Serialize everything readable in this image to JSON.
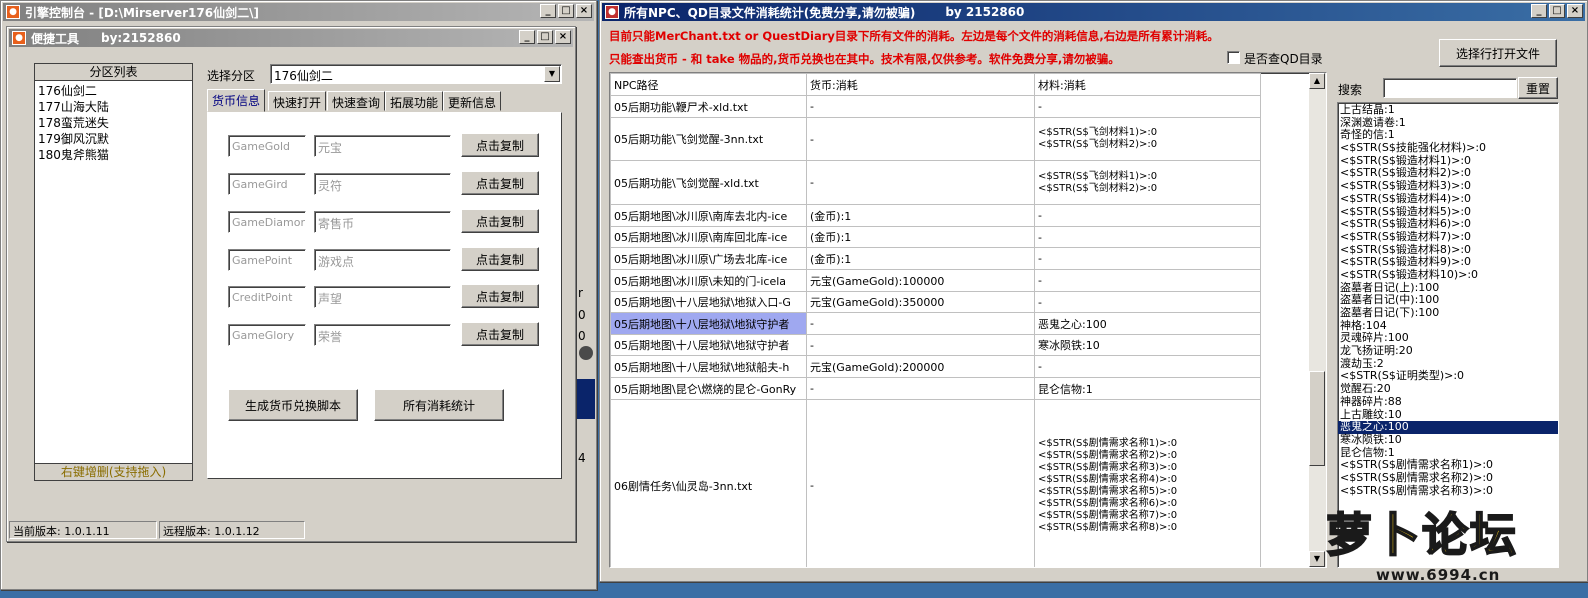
{
  "console_window": {
    "title": "引擎控制台 - [D:\\Mirserver176仙剑二\\]",
    "controls": [
      "_",
      "□",
      "×"
    ]
  },
  "tool_window": {
    "title": "便捷工具",
    "author": "by:2152860",
    "zone_list": {
      "header": "分区列表",
      "items": [
        "176仙剑二",
        "177山海大陆",
        "178蛮荒迷失",
        "179御风沉默",
        "180鬼斧熊猫"
      ],
      "footer": "右键增删(支持拖入)"
    },
    "select_zone": {
      "label": "选择分区",
      "value": "176仙剑二"
    },
    "tabs": [
      "货币信息",
      "快速打开",
      "快速查询",
      "拓展功能",
      "更新信息"
    ],
    "currency_rows": [
      {
        "code": "GameGold",
        "name": "元宝",
        "button": "点击复制"
      },
      {
        "code": "GameGird",
        "name": "灵符",
        "button": "点击复制"
      },
      {
        "code": "GameDiamond",
        "name": "寄售币",
        "button": "点击复制"
      },
      {
        "code": "GamePoint",
        "name": "游戏点",
        "button": "点击复制"
      },
      {
        "code": "CreditPoint",
        "name": "声望",
        "button": "点击复制"
      },
      {
        "code": "GameGlory",
        "name": "荣誉",
        "button": "点击复制"
      }
    ],
    "generate_button": "生成货币兑换脚本",
    "stats_button": "所有消耗统计",
    "status": {
      "current": "当前版本: 1.0.1.11",
      "remote": "远程版本: 1.0.1.12"
    }
  },
  "behind_fragments": [
    "r",
    "0",
    "0",
    "4"
  ],
  "stats_window": {
    "title": "所有NPC、QD目录文件消耗统计(免费分享,请勿被骗)",
    "author": "by 2152860",
    "notice1": "目前只能MerChant.txt or QuestDiary目录下所有文件的消耗。左边是每个文件的消耗信息,右边是所有累计消耗。",
    "notice2": "只能查出货币 - 和 take 物品的,货币兑换也在其中。技术有限,仅供参考。软件免费分享,请勿被骗。",
    "checkbox_label": "是否查QD目录",
    "open_file_button": "选择行打开文件",
    "search_label": "搜索",
    "search_value": "",
    "reset_button": "重置",
    "table": {
      "headers": [
        "NPC路径",
        "货币:消耗",
        "材料:消耗"
      ],
      "rows": [
        {
          "path": "05后期功能\\鞭尸术-xld.txt",
          "currency": "-",
          "materials": [
            "-"
          ]
        },
        {
          "path": "05后期功能\\飞剑觉醒-3nn.txt",
          "currency": "-",
          "materials": [
            "<$STR(S$飞剑材料1)>:0",
            "<$STR(S$飞剑材料2)>:0"
          ]
        },
        {
          "path": "05后期功能\\飞剑觉醒-xld.txt",
          "currency": "-",
          "materials": [
            "<$STR(S$飞剑材料1)>:0",
            "<$STR(S$飞剑材料2)>:0"
          ]
        },
        {
          "path": "05后期地图\\冰川原\\南库去北内-ice",
          "currency": "(金币):1",
          "materials": [
            "-"
          ]
        },
        {
          "path": "05后期地图\\冰川原\\南库回北库-ice",
          "currency": "(金币):1",
          "materials": [
            "-"
          ]
        },
        {
          "path": "05后期地图\\冰川原\\广场去北库-ice",
          "currency": "(金币):1",
          "materials": [
            "-"
          ]
        },
        {
          "path": "05后期地图\\冰川原\\未知的门-icela",
          "currency": "元宝(GameGold):100000",
          "materials": [
            "-"
          ]
        },
        {
          "path": "05后期地图\\十八层地狱\\地狱入口-G",
          "currency": "元宝(GameGold):350000",
          "materials": [
            "-"
          ]
        },
        {
          "path": "05后期地图\\十八层地狱\\地狱守护者",
          "currency": "-",
          "materials": [
            "恶鬼之心:100"
          ],
          "selected": true
        },
        {
          "path": "05后期地图\\十八层地狱\\地狱守护者",
          "currency": "-",
          "materials": [
            "寒冰陨铁:10"
          ]
        },
        {
          "path": "05后期地图\\十八层地狱\\地狱船夫-h",
          "currency": "元宝(GameGold):200000",
          "materials": [
            "-"
          ]
        },
        {
          "path": "05后期地图\\昆仑\\燃烧的昆仑-GonRy",
          "currency": "-",
          "materials": [
            "昆仑信物:1"
          ]
        },
        {
          "path": "06剧情任务\\仙灵岛-3nn.txt",
          "currency": "-",
          "materials": [
            "<$STR(S$剧情需求名称1)>:0",
            "<$STR(S$剧情需求名称2)>:0",
            "<$STR(S$剧情需求名称3)>:0",
            "<$STR(S$剧情需求名称4)>:0",
            "<$STR(S$剧情需求名称5)>:0",
            "<$STR(S$剧情需求名称6)>:0",
            "<$STR(S$剧情需求名称7)>:0",
            "<$STR(S$剧情需求名称8)>:0"
          ]
        }
      ]
    },
    "totals_list": [
      "上古结晶:1",
      "深渊邀请卷:1",
      "奇怪的信:1",
      "<$STR(S$技能强化材料)>:0",
      "<$STR(S$锻造材料1)>:0",
      "<$STR(S$锻造材料2)>:0",
      "<$STR(S$锻造材料3)>:0",
      "<$STR(S$锻造材料4)>:0",
      "<$STR(S$锻造材料5)>:0",
      "<$STR(S$锻造材料6)>:0",
      "<$STR(S$锻造材料7)>:0",
      "<$STR(S$锻造材料8)>:0",
      "<$STR(S$锻造材料9)>:0",
      "<$STR(S$锻造材料10)>:0",
      "盗墓者日记(上):100",
      "盗墓者日记(中):100",
      "盗墓者日记(下):100",
      "神格:104",
      "灵魂碎片:100",
      "龙飞扬证明:20",
      "渡劫玉:2",
      "<$STR(S$证明类型)>:0",
      "觉醒石:20",
      "神器碎片:88",
      "上古雕纹:10",
      "恶鬼之心:100",
      "寒冰陨铁:10",
      "昆仑信物:1",
      "<$STR(S$剧情需求名称1)>:0",
      "<$STR(S$剧情需求名称2)>:0",
      "<$STR(S$剧情需求名称3)>:0"
    ],
    "totals_selected_index": 25
  },
  "watermark": {
    "text": "萝卜论坛",
    "url": "www.6994.cn"
  },
  "colors": {
    "notice_red": "#e00000",
    "selection_blue": "#0a246a",
    "row_highlight": "#9fa8f0"
  }
}
